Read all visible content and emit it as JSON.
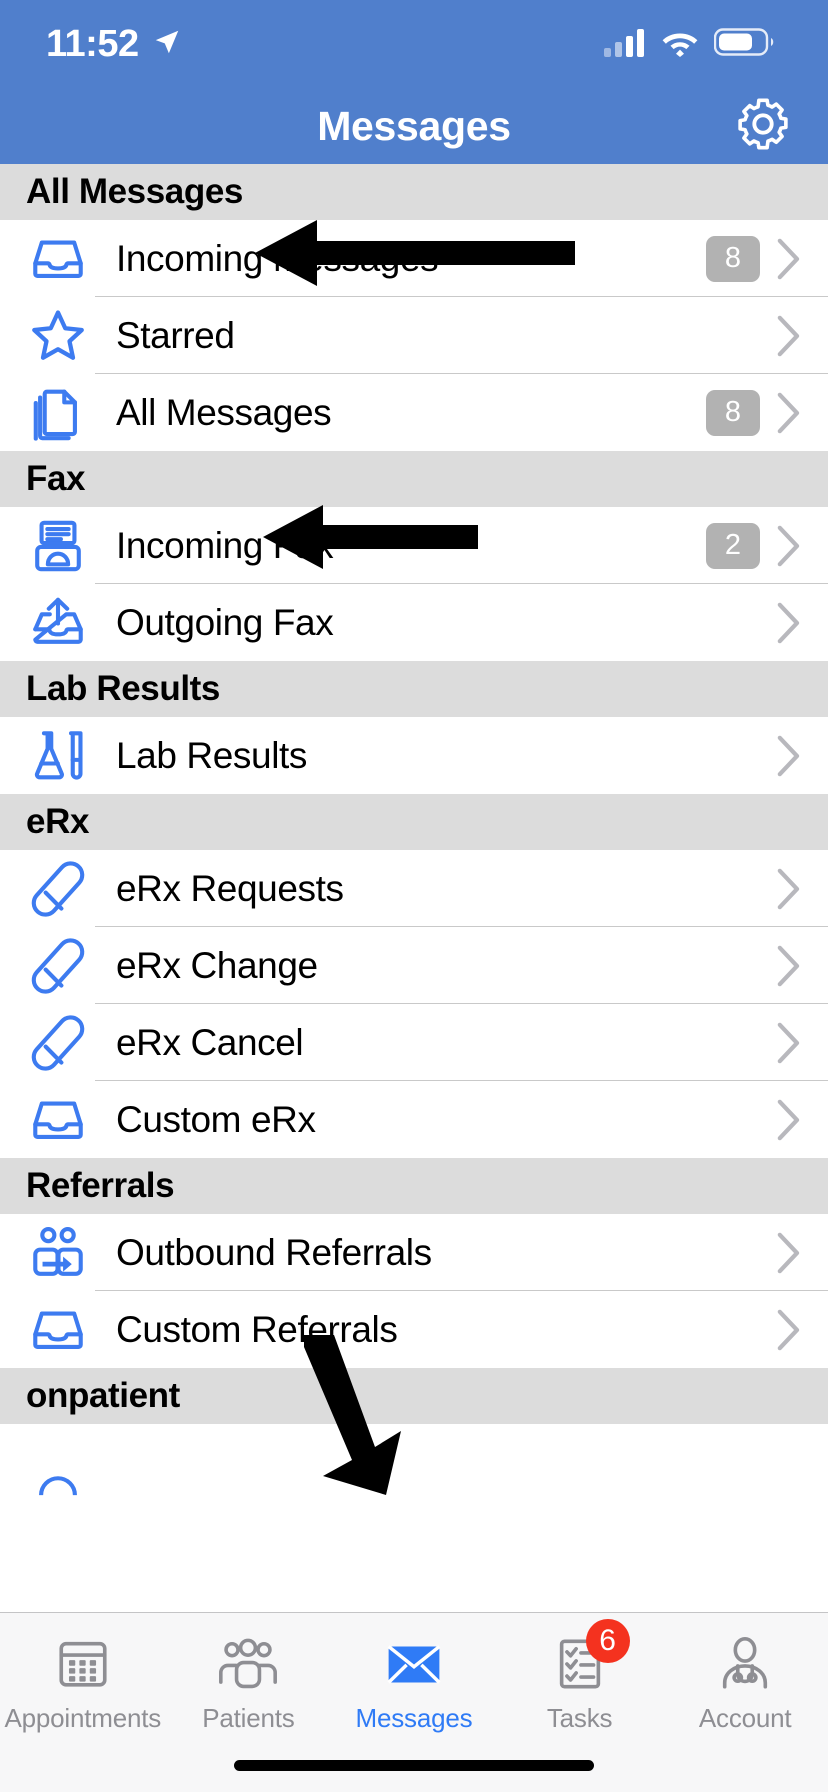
{
  "status_bar": {
    "time": "11:52",
    "location_icon": "location-arrow-icon",
    "cellular_icon": "cellular-signal-icon",
    "wifi_icon": "wifi-icon",
    "battery_icon": "battery-icon",
    "battery_level_pct": 70
  },
  "nav": {
    "title": "Messages",
    "settings_icon": "gear-icon"
  },
  "colors": {
    "header_blue": "#507fcc",
    "icon_blue": "#3d7bf0",
    "section_gray": "#dcdcdc",
    "badge_gray": "#b2b2b2",
    "tab_active_blue": "#2f7bf6",
    "tab_inactive_gray": "#8e8e93",
    "badge_red": "#f4321f"
  },
  "sections": [
    {
      "title": "All Messages",
      "rows": [
        {
          "label": "Incoming Messages",
          "icon": "inbox-tray-icon",
          "badge": "8"
        },
        {
          "label": "Starred",
          "icon": "star-icon",
          "badge": ""
        },
        {
          "label": "All Messages",
          "icon": "stacked-pages-icon",
          "badge": "8"
        }
      ]
    },
    {
      "title": "Fax",
      "rows": [
        {
          "label": "Incoming Fax",
          "icon": "fax-machine-icon",
          "badge": "2"
        },
        {
          "label": "Outgoing Fax",
          "icon": "outbox-upload-icon",
          "badge": ""
        }
      ]
    },
    {
      "title": "Lab Results",
      "rows": [
        {
          "label": "Lab Results",
          "icon": "flask-test-tube-icon",
          "badge": ""
        }
      ]
    },
    {
      "title": "eRx",
      "rows": [
        {
          "label": "eRx Requests",
          "icon": "pill-capsule-icon",
          "badge": ""
        },
        {
          "label": "eRx Change",
          "icon": "pill-capsule-icon",
          "badge": ""
        },
        {
          "label": "eRx Cancel",
          "icon": "pill-capsule-icon",
          "badge": ""
        },
        {
          "label": "Custom eRx",
          "icon": "inbox-tray-icon",
          "badge": ""
        }
      ]
    },
    {
      "title": "Referrals",
      "rows": [
        {
          "label": "Outbound Referrals",
          "icon": "people-arrow-icon",
          "badge": ""
        },
        {
          "label": "Custom Referrals",
          "icon": "inbox-tray-icon",
          "badge": ""
        }
      ]
    },
    {
      "title": "onpatient",
      "rows": []
    }
  ],
  "tabs": [
    {
      "label": "Appointments",
      "icon": "calendar-icon",
      "active": false,
      "badge": ""
    },
    {
      "label": "Patients",
      "icon": "people-group-icon",
      "active": false,
      "badge": ""
    },
    {
      "label": "Messages",
      "icon": "envelope-icon",
      "active": true,
      "badge": ""
    },
    {
      "label": "Tasks",
      "icon": "checklist-icon",
      "active": false,
      "badge": "6"
    },
    {
      "label": "Account",
      "icon": "doctor-stethoscope-icon",
      "active": false,
      "badge": ""
    }
  ],
  "annotations": [
    {
      "name": "arrow-to-incoming-messages",
      "direction": "left"
    },
    {
      "name": "arrow-to-incoming-fax",
      "direction": "left"
    },
    {
      "name": "arrow-to-messages-tab",
      "direction": "down-right"
    }
  ]
}
